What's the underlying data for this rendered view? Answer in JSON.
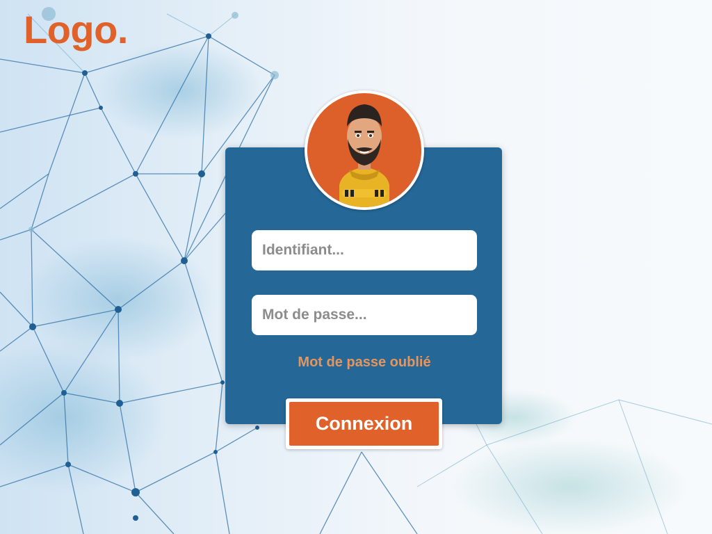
{
  "brand": {
    "logo_text": "Logo.",
    "accent_color": "#e0622a",
    "card_color": "#256898",
    "link_color": "#e8945a"
  },
  "login": {
    "avatar_icon": "user-avatar-icon",
    "username": {
      "placeholder": "Identifiant...",
      "value": ""
    },
    "password": {
      "placeholder": "Mot de passe...",
      "value": ""
    },
    "forgot_password_label": "Mot de passe oublié",
    "submit_label": "Connexion"
  },
  "background": {
    "icon": "network-mesh-icon"
  }
}
